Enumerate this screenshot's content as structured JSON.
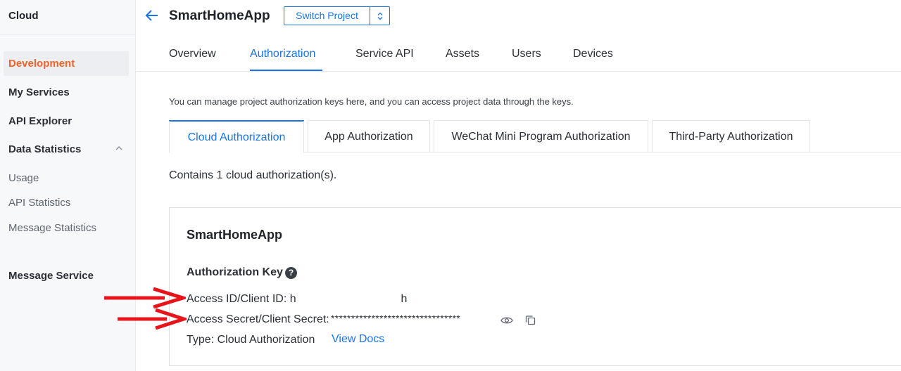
{
  "sidebar": {
    "brand": "Cloud",
    "items": [
      {
        "label": "Development",
        "active": true
      },
      {
        "label": "My Services"
      },
      {
        "label": "API Explorer"
      },
      {
        "label": "Data Statistics",
        "expanded": true
      },
      {
        "label": "Usage",
        "sub": true
      },
      {
        "label": "API Statistics",
        "sub": true
      },
      {
        "label": "Message Statistics",
        "sub": true
      },
      {
        "label": "Message Service"
      }
    ]
  },
  "header": {
    "title": "SmartHomeApp",
    "switch_label": "Switch Project"
  },
  "tabs": [
    {
      "label": "Overview"
    },
    {
      "label": "Authorization",
      "active": true
    },
    {
      "label": "Service API"
    },
    {
      "label": "Assets"
    },
    {
      "label": "Users"
    },
    {
      "label": "Devices"
    }
  ],
  "description": "You can manage project authorization keys here, and you can access project data through the keys.",
  "sub_tabs": [
    {
      "label": "Cloud Authorization",
      "active": true
    },
    {
      "label": "App Authorization"
    },
    {
      "label": "WeChat Mini Program Authorization"
    },
    {
      "label": "Third-Party Authorization"
    }
  ],
  "count_text": "Contains 1 cloud authorization(s).",
  "card": {
    "title": "SmartHomeApp",
    "key_heading": "Authorization Key",
    "access_id_label": "Access ID/Client ID: h",
    "access_id_suffix": "h",
    "secret_label": "Access Secret/Client Secret:",
    "secret_value": "********************************",
    "type_label": "Type: Cloud Authorization",
    "view_docs": "View Docs"
  },
  "colors": {
    "accent": "#1a73e8",
    "active_nav": "#f0642a",
    "annotation_arrow": "#e8141b"
  }
}
